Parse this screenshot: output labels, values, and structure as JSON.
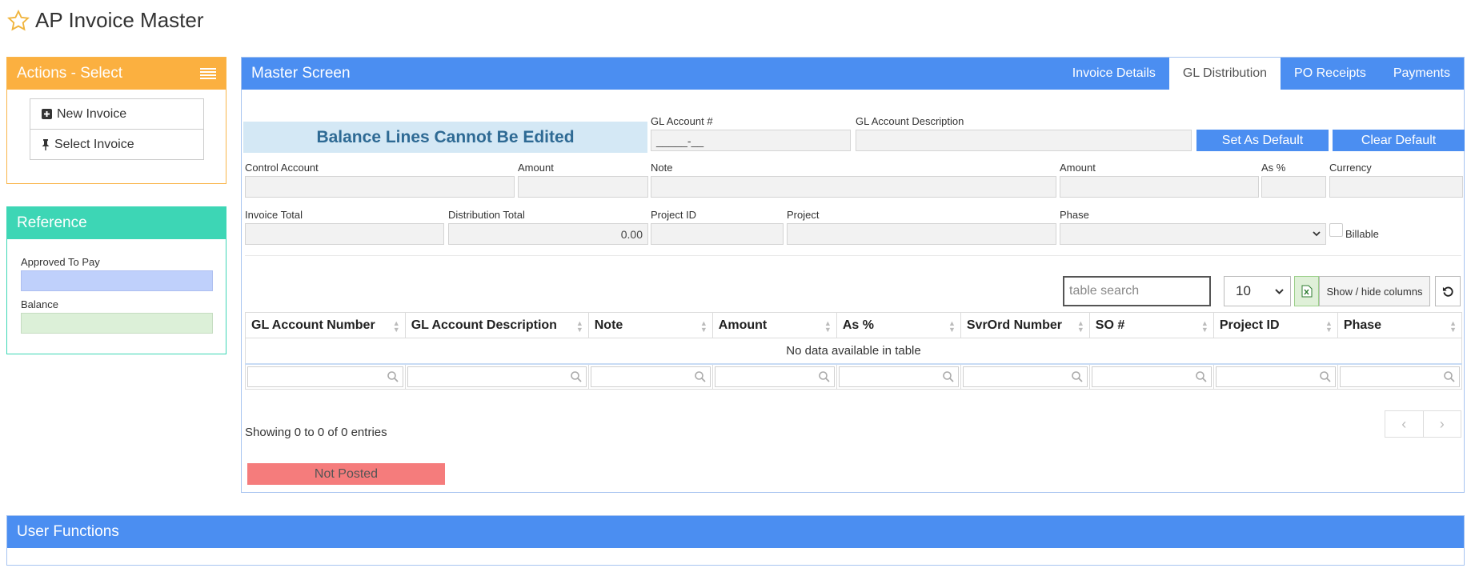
{
  "page": {
    "title": "AP Invoice Master"
  },
  "actions": {
    "title": "Actions - Select",
    "items": [
      {
        "label": "New Invoice",
        "icon": "plus-square-icon"
      },
      {
        "label": "Select Invoice",
        "icon": "pushpin-icon"
      }
    ]
  },
  "reference": {
    "title": "Reference",
    "approved_label": "Approved To Pay",
    "balance_label": "Balance",
    "approved_color": "#bfd0fb",
    "balance_color": "#dcf0d8"
  },
  "master": {
    "title": "Master Screen",
    "tabs": [
      {
        "label": "Invoice Details",
        "active": false
      },
      {
        "label": "GL Distribution",
        "active": true
      },
      {
        "label": "PO Receipts",
        "active": false
      },
      {
        "label": "Payments",
        "active": false
      }
    ]
  },
  "form": {
    "banner": "Balance Lines Cannot Be Edited",
    "gl_account_label": "GL Account #",
    "gl_account_value": "_____-__",
    "gl_desc_label": "GL Account Description",
    "set_default": "Set As Default",
    "clear_default": "Clear Default",
    "control_account_label": "Control Account",
    "amount_label": "Amount",
    "note_label": "Note",
    "amount2_label": "Amount",
    "as_pct_label": "As %",
    "currency_label": "Currency",
    "invoice_total_label": "Invoice Total",
    "dist_total_label": "Distribution Total",
    "dist_total_value": "0.00",
    "project_id_label": "Project ID",
    "project_label": "Project",
    "phase_label": "Phase",
    "billable_label": "Billable"
  },
  "table": {
    "search_placeholder": "table search",
    "page_size": "10",
    "show_hide": "Show / hide columns",
    "columns": [
      "GL Account Number",
      "GL Account Description",
      "Note",
      "Amount",
      "As %",
      "SvrOrd Number",
      "SO #",
      "Project ID",
      "Phase"
    ],
    "empty": "No data available in table",
    "info": "Showing 0 to 0 of 0 entries",
    "prev": "‹",
    "next": "›"
  },
  "status": {
    "label": "Not Posted",
    "color": "#f57c7c"
  },
  "user_functions": {
    "title": "User Functions"
  },
  "colors": {
    "orange": "#fbb040",
    "teal": "#3dd6b5",
    "blue": "#4b8ef1"
  }
}
